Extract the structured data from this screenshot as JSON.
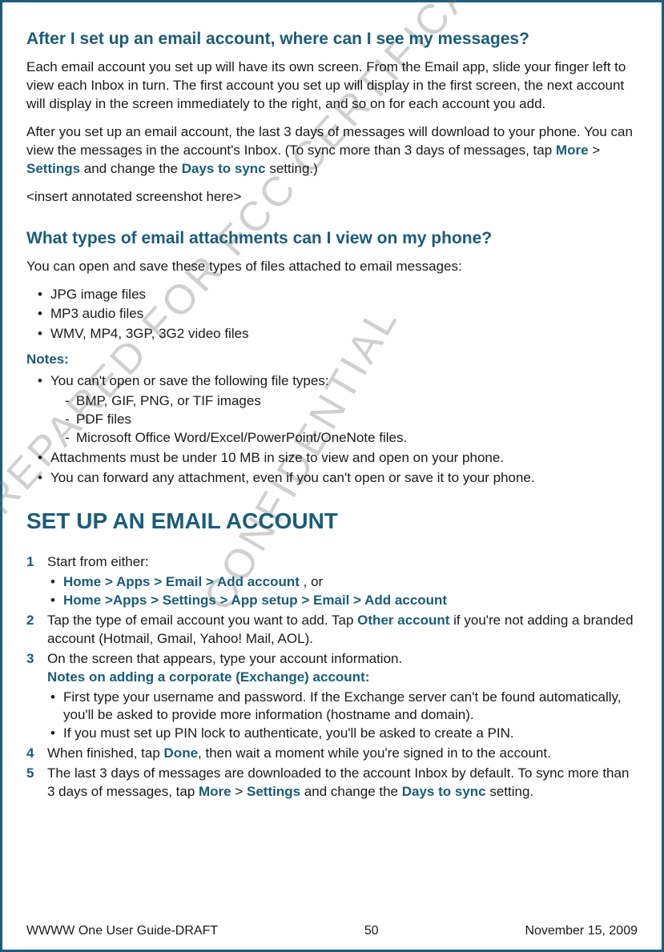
{
  "watermarks": {
    "wm1": "PREPARED FOR FCC CERTIFICATION",
    "wm2": "CONFIDENTIAL"
  },
  "q1": {
    "heading": "After I set up an email account, where can I see my messages?",
    "p1": "Each email account you set up will have its own screen. From the Email app, slide your finger left to view each Inbox in turn. The first account you set up will display in the first screen, the next account will display in the screen immediately to the right, and so on for each account you add.",
    "p2a": "After you set up an email account, the last 3 days of messages will download to your phone. You can view the messages in the account's Inbox. (To sync more than 3 days of messages, tap ",
    "more": "More",
    "gt1": " > ",
    "settings": "Settings",
    "p2b": " and change the ",
    "days": "Days to sync",
    "p2c": " setting.)",
    "placeholder": "<insert annotated screenshot here>"
  },
  "q2": {
    "heading": "What types of email attachments can I view on my phone?",
    "intro": "You can open and save these types of files attached to email messages:",
    "bullets": [
      "JPG image files",
      "MP3 audio files",
      "WMV, MP4, 3GP, 3G2 video files"
    ],
    "notes_label": "Notes:",
    "note1_lead": "You can't open or save the following file types:",
    "note1_items": [
      "BMP, GIF, PNG, or TIF images",
      "PDF files",
      "Microsoft Office Word/Excel/PowerPoint/OneNote files."
    ],
    "note2": "Attachments must be under 10 MB in size to view and open on your phone.",
    "note3": "You can forward any attachment, even if you can't open or save it to your phone."
  },
  "section": {
    "heading": "SET UP AN EMAIL ACCOUNT",
    "step1": "Start from either:",
    "step1_b1": "Home > Apps > Email > Add account",
    "step1_b1_tail": " , or",
    "step1_b2": "Home >Apps > Settings > App setup > Email > Add account",
    "step2a": "Tap the type of email account you want to add. Tap ",
    "step2_other": "Other account",
    "step2b": " if you're not adding a branded account (Hotmail, Gmail, Yahoo! Mail, AOL).",
    "step3": "On the screen that appears, type your account information.",
    "step3_notes": "Notes on adding a corporate (Exchange) account:",
    "step3_b1": "First type your username and password. If the Exchange server can't be found automatically, you'll be asked to provide more information (hostname and domain).",
    "step3_b2": "If you must set up PIN lock to authenticate, you'll be asked to create a PIN.",
    "step4a": "When finished, tap ",
    "step4_done": "Done",
    "step4b": ", then wait a moment while you're signed in to the account.",
    "step5a": "The last 3 days of messages are downloaded to the account Inbox by default. To sync more than 3 days of messages, tap ",
    "step5_more": "More",
    "step5_gt": " > ",
    "step5_settings": "Settings",
    "step5b": " and change the ",
    "step5_days": "Days to sync",
    "step5c": " setting."
  },
  "footer": {
    "left": "WWWW One User Guide-DRAFT",
    "center": "50",
    "right": "November 15, 2009"
  }
}
